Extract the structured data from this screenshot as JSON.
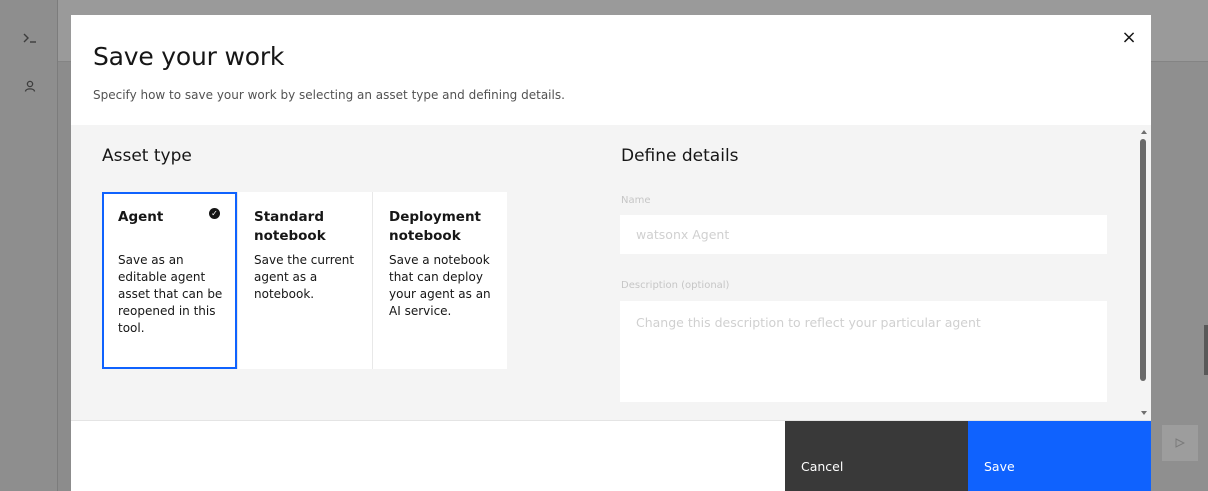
{
  "background": {
    "rail_icons": [
      "terminal-icon",
      "user-icon"
    ],
    "send_icon": "send-icon"
  },
  "modal": {
    "title": "Save your work",
    "subtitle": "Specify how to save your work by selecting an asset type and defining details.",
    "close_icon": "close-icon",
    "close_glyph": "×"
  },
  "asset_type": {
    "heading": "Asset type",
    "options": [
      {
        "title": "Agent",
        "description": "Save as an editable agent asset that can be reopened in this tool.",
        "selected": true
      },
      {
        "title": "Standard notebook",
        "description": "Save the current agent as a notebook.",
        "selected": false
      },
      {
        "title": "Deployment notebook",
        "description": "Save a notebook that can deploy your agent as an AI service.",
        "selected": false
      }
    ],
    "selected_check_glyph": "✓"
  },
  "details": {
    "heading": "Define details",
    "name_label": "Name",
    "name_placeholder": "watsonx Agent",
    "name_value": "",
    "description_label": "Description (optional)",
    "description_placeholder": "Change this description to reflect your particular agent",
    "description_value": ""
  },
  "footer": {
    "cancel_label": "Cancel",
    "save_label": "Save"
  },
  "colors": {
    "primary": "#0f62fe",
    "secondary_button": "#393939",
    "body_background": "#f4f4f4"
  }
}
